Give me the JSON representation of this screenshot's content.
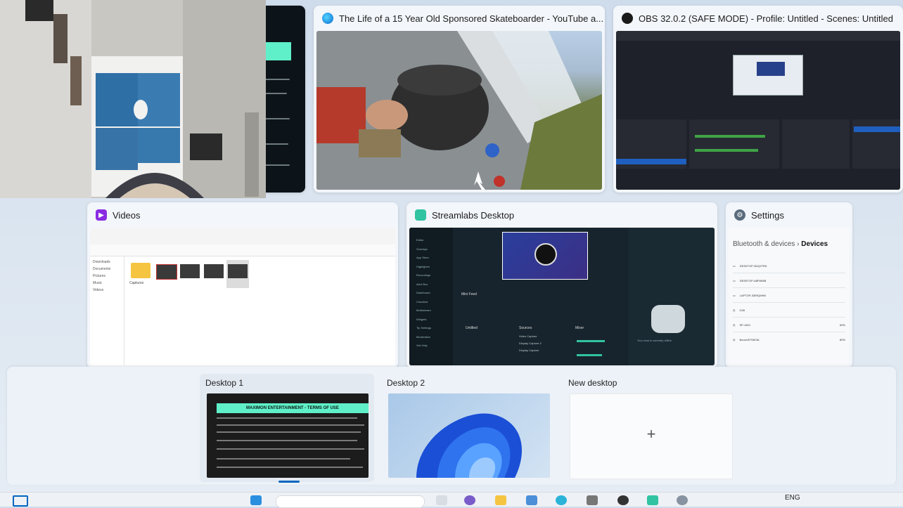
{
  "windows": {
    "youtube": {
      "title": "The Life of a 15 Year Old Sponsored Skateboarder - YouTube a..."
    },
    "obs": {
      "title": "OBS 32.0.2 (SAFE MODE) - Profile: Untitled - Scenes: Untitled"
    },
    "videos": {
      "title": "Videos",
      "sidebar": [
        "Downloads",
        "Documents",
        "Pictures",
        "Music",
        "Videos"
      ],
      "files": [
        "Captures",
        "",
        "",
        "",
        ""
      ]
    },
    "streamlabs": {
      "title": "Streamlabs Desktop",
      "panels": {
        "mini_feed": "Mini Feed",
        "scenes": "Untitled",
        "sources": "Sources",
        "mixer": "Mixer"
      },
      "offline_text": "Your chat is currently offline",
      "source_items": [
        "Video Capture",
        "Display Capture 2",
        "Display Capture"
      ],
      "nav_items": [
        "Editor",
        "Overlays",
        "App Store",
        "Highlighter",
        "Recordings",
        "Alert Box",
        "Dashboard",
        "Cloudbot",
        "Multistream",
        "Widgets",
        "Tip Settings",
        "Moderation",
        "Get Help"
      ]
    },
    "settings": {
      "title": "Settings",
      "breadcrumb_parent": "Bluetooth & devices",
      "breadcrumb_current": "Devices",
      "devices": [
        "DESKTOP-3DQZ7RK",
        "DESKTOP-A8F8K8B",
        "LAPTOP-33IRQ5HM",
        "G35",
        "SP-1821",
        "Boost-B7S8C6L"
      ],
      "battery": [
        "",
        "",
        "",
        "",
        "60%",
        "80%"
      ]
    }
  },
  "desktops": {
    "desktop1": {
      "label": "Desktop 1",
      "thumb_title": "MAXIMON ENTERTAINMENT - TERMS OF USE"
    },
    "desktop2": {
      "label": "Desktop 2"
    },
    "new": {
      "label": "New desktop",
      "plus": "+"
    }
  },
  "taskbar": {
    "lang": "ENG"
  },
  "colors": {
    "accent": "#0067c0",
    "obs_blue": "#1f5fbf",
    "teal": "#5ff0c9",
    "streamlabs": "#31c3a2"
  }
}
